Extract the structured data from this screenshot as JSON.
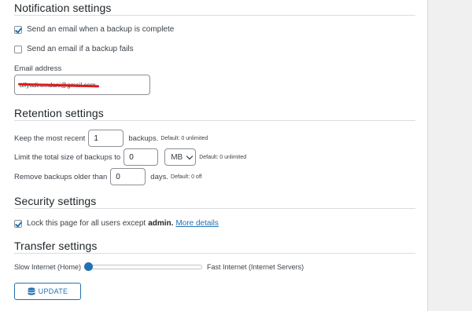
{
  "notification": {
    "title": "Notification settings",
    "email_complete_label": "Send an email when a backup is complete",
    "email_complete_checked": true,
    "email_fail_label": "Send an email if a backup fails",
    "email_fail_checked": false,
    "email_address_label": "Email address",
    "email_address_value": "alfyadiromdani@gmail.com"
  },
  "retention": {
    "title": "Retention settings",
    "keep_recent_label": "Keep the most recent",
    "keep_recent_value": "1",
    "keep_recent_unit": "backups.",
    "keep_recent_hint": "Default: 0 unlimited",
    "total_size_label": "Limit the total size of backups to",
    "total_size_value": "0",
    "total_size_unit": "MB",
    "total_size_hint": "Default: 0 unlimited",
    "older_than_label": "Remove backups older than",
    "older_than_value": "0",
    "older_than_unit": "days.",
    "older_than_hint": "Default: 0 off"
  },
  "security": {
    "title": "Security settings",
    "lock_label_prefix": "Lock this page for all users except",
    "lock_label_user": "admin.",
    "lock_checked": true,
    "more_details_link": "More details"
  },
  "transfer": {
    "title": "Transfer settings",
    "slow_label": "Slow Internet (Home)",
    "fast_label": "Fast Internet (Internet Servers)",
    "slider_value": 0
  },
  "update_button": "UPDATE",
  "colors": {
    "accent": "#2271b1",
    "redact": "#e01a1a"
  }
}
